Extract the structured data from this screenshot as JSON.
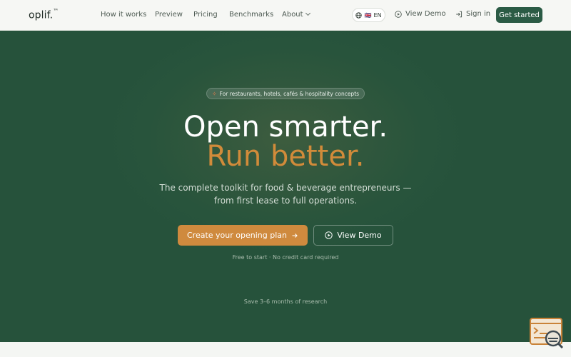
{
  "nav": {
    "logo": "oplif.",
    "logo_mark": "™",
    "links": [
      "How it works",
      "Preview",
      "Pricing",
      "Benchmarks",
      "About"
    ],
    "lang_flag": "🇬🇧",
    "lang_code": "EN",
    "view_demo": "View Demo",
    "sign_in": "Sign in",
    "get_started": "Get started"
  },
  "hero": {
    "badge": "For restaurants, hotels, cafés & hospitality concepts",
    "headline_1": "Open smarter.",
    "headline_2": "Run better.",
    "subtitle_1": "The complete toolkit for food & beverage entrepreneurs —",
    "subtitle_2": "from first lease to full operations.",
    "primary_cta": "Create your opening plan",
    "secondary_cta": "View Demo",
    "note": "Free to start · No credit card required",
    "save_note": "Save 3–6 months of research"
  },
  "colors": {
    "brand_green": "#2b5b45",
    "hero_bg": "#28543c",
    "accent": "#cf8a3e"
  },
  "icons": [
    "globe-icon",
    "play-circle-icon",
    "sign-in-icon",
    "arrow-right-icon",
    "sparkle-icon",
    "help-widget-icon"
  ]
}
